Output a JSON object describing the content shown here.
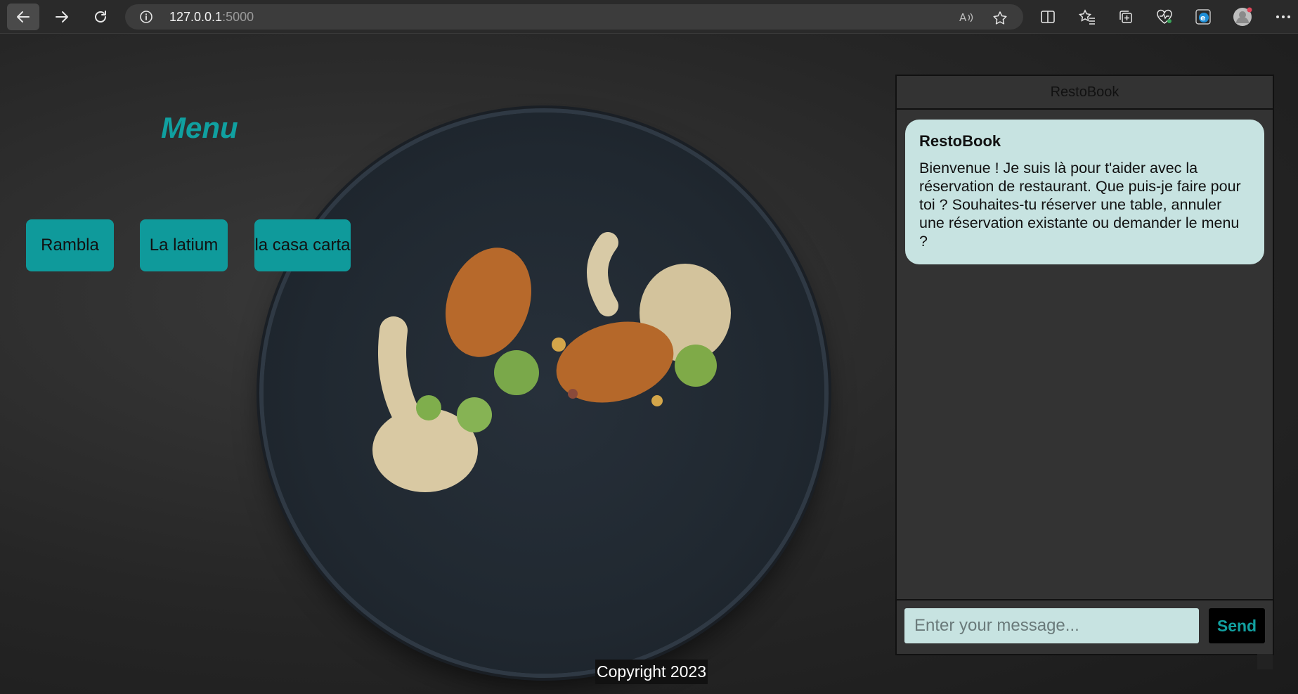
{
  "browser": {
    "url_host": "127.0.0.1",
    "url_port": ":5000"
  },
  "page": {
    "menu_title": "Menu",
    "restaurants": [
      "Rambla",
      "La latium",
      "la casa carta"
    ],
    "footer": "Copyright 2023"
  },
  "chat": {
    "header": "RestoBook",
    "messages": [
      {
        "author": "RestoBook",
        "text": "Bienvenue ! Je suis là pour t'aider avec la réservation de restaurant. Que puis-je faire pour toi ? Souhaites-tu réserver une table, annuler une réservation existante ou demander le menu ?"
      }
    ],
    "input_placeholder": "Enter your message...",
    "send_label": "Send"
  },
  "colors": {
    "accent": "#0f9a9b",
    "bubble": "#c7e3e1",
    "panel": "#333333"
  }
}
